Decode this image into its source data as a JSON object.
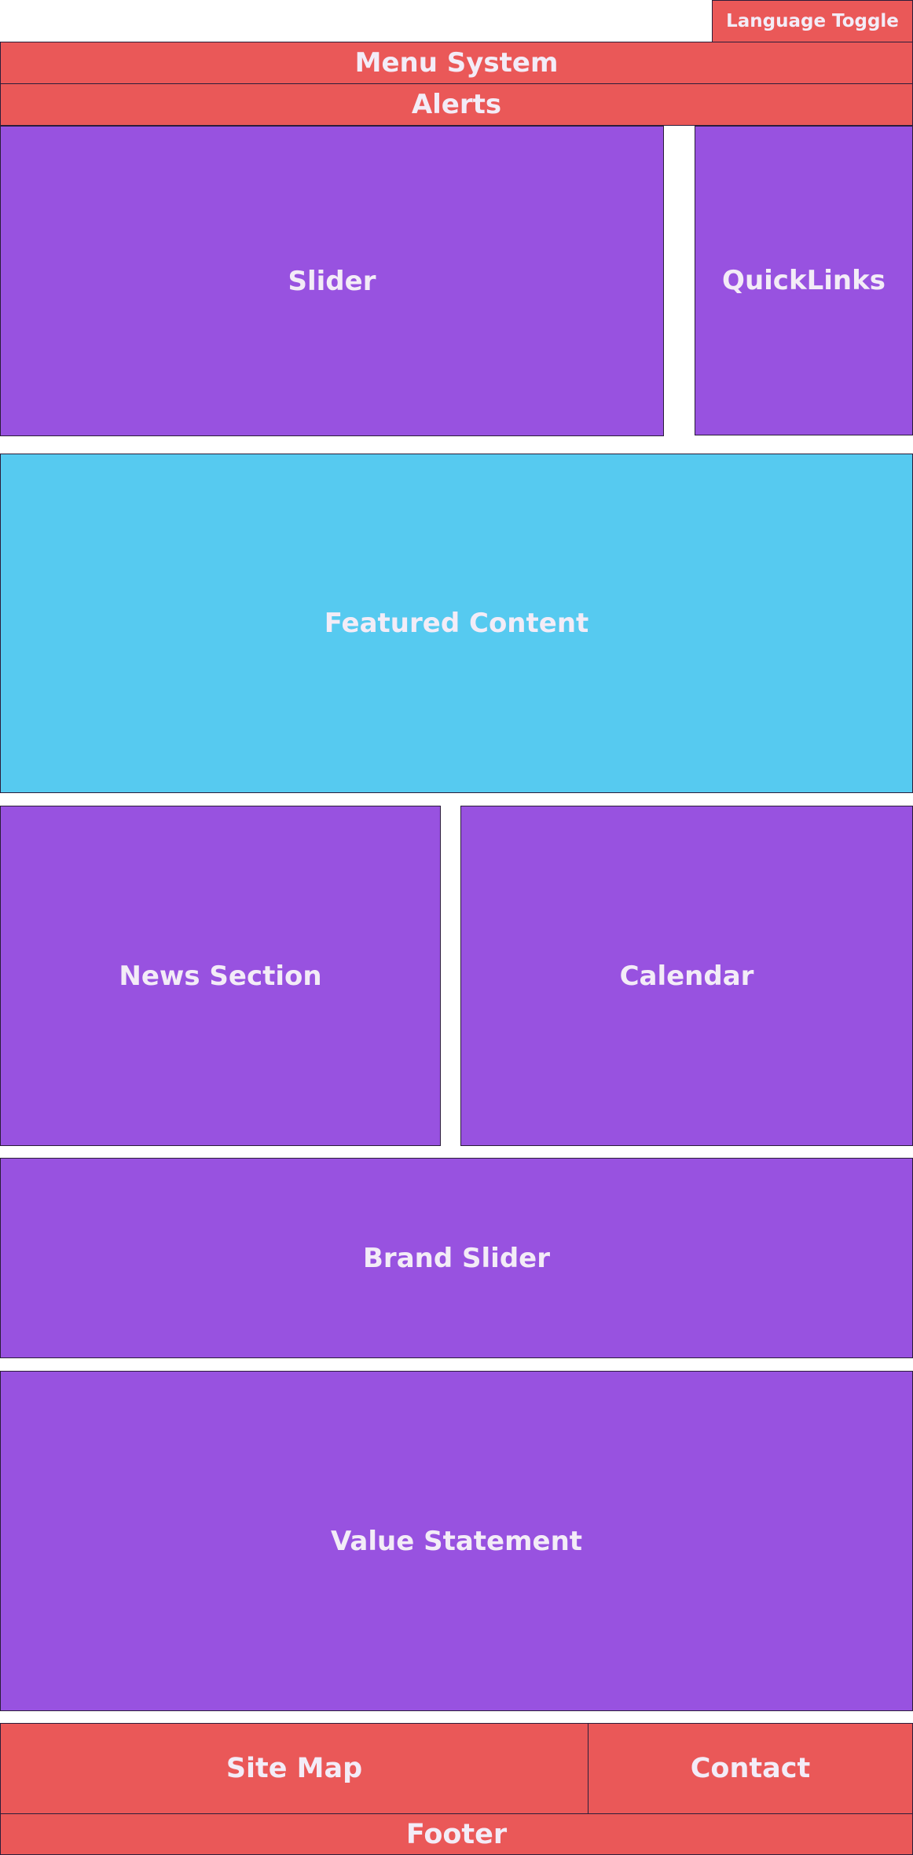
{
  "blocks": {
    "language_toggle": "Language Toggle",
    "menu_system": "Menu System",
    "alerts": "Alerts",
    "slider": "Slider",
    "quicklinks": "QuickLinks",
    "featured_content": "Featured Content",
    "news_section": "News Section",
    "calendar": "Calendar",
    "brand_slider": "Brand Slider",
    "value_statement": "Value Statement",
    "site_map": "Site Map",
    "contact": "Contact",
    "footer": "Footer"
  },
  "colors": {
    "red": "#ea5858",
    "purple": "#9852e0",
    "blue": "#56caf0",
    "text": "#f3ecf7",
    "border": "#2b1d3a"
  }
}
